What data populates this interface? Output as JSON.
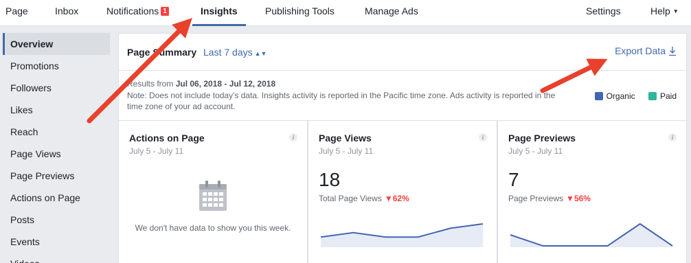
{
  "nav": {
    "page": "Page",
    "inbox": "Inbox",
    "notifications": "Notifications",
    "notifications_badge": "1",
    "insights": "Insights",
    "publishing_tools": "Publishing Tools",
    "manage_ads": "Manage Ads",
    "settings": "Settings",
    "help": "Help"
  },
  "sidebar": {
    "items": [
      "Overview",
      "Promotions",
      "Followers",
      "Likes",
      "Reach",
      "Page Views",
      "Page Previews",
      "Actions on Page",
      "Posts",
      "Events",
      "Videos"
    ]
  },
  "summary": {
    "title": "Page Summary",
    "range": "Last 7 days",
    "export": "Export Data",
    "results_prefix": "Results from ",
    "results_dates": "Jul 06, 2018 - Jul 12, 2018",
    "note": "Note: Does not include today's data. Insights activity is reported in the Pacific time zone. Ads activity is reported in the time zone of your ad account.",
    "legend": [
      {
        "label": "Organic",
        "color": "#4267b2"
      },
      {
        "label": "Paid",
        "color": "#2fb69a"
      }
    ]
  },
  "cards": {
    "actions": {
      "title": "Actions on Page",
      "dates": "July 5 - July 11",
      "empty": "We don't have data to show you this week."
    },
    "views": {
      "title": "Page Views",
      "dates": "July 5 - July 11",
      "value": "18",
      "label": "Total Page Views",
      "delta": "62%",
      "trend": [
        2,
        3,
        2,
        2,
        4,
        5
      ]
    },
    "previews": {
      "title": "Page Previews",
      "dates": "July 5 - July 11",
      "value": "7",
      "label": "Page Previews",
      "delta": "56%",
      "trend": [
        2,
        0,
        0,
        0,
        4,
        0
      ]
    }
  },
  "colors": {
    "accent": "#4267b2",
    "negative": "#fa3e3e",
    "annotation_arrow": "#e8412c"
  }
}
